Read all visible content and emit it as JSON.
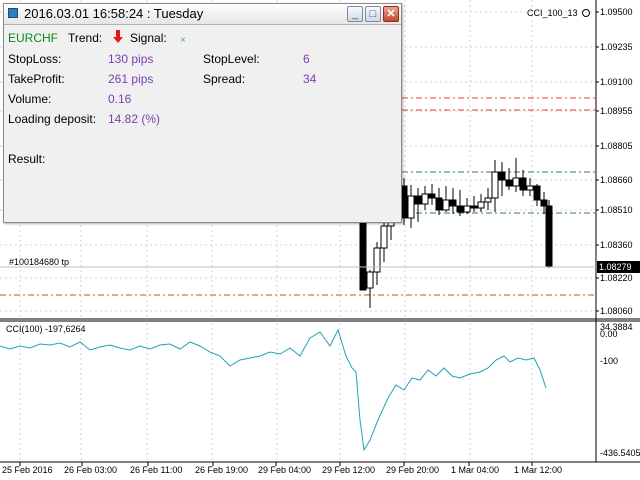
{
  "chart": {
    "indicator_name": "CCI_100_13",
    "price_tag": "1.08279",
    "order_label": "#100184680 tp",
    "price_ticks": [
      "1.09500",
      "1.09235",
      "1.09100",
      "1.08955",
      "1.08805",
      "1.08660",
      "1.08510",
      "1.08360",
      "1.08220",
      "1.08060"
    ],
    "cci_label": "CCI(100) -197,6264",
    "cci_ticks": [
      "34.3884",
      "0.00",
      "-100",
      "-436.5405"
    ],
    "time_ticks": [
      "25 Feb 2016",
      "26 Feb 03:00",
      "26 Feb 11:00",
      "26 Feb 19:00",
      "29 Feb 04:00",
      "29 Feb 12:00",
      "29 Feb 20:00",
      "1 Mar 04:00",
      "1 Mar 12:00"
    ],
    "colors": {
      "cci_line": "#22a3b4",
      "level_red": "#e0471c",
      "level_green": "#2f8a2f",
      "price_tag_bg": "#000000"
    }
  },
  "panel": {
    "title": "2016.03.01 16:58:24 : Tuesday",
    "symbol": "EURCHF",
    "trend_label": "Trend:",
    "trend_icon": "down-arrow-icon",
    "signal_label": "Signal:",
    "signal_icon": "small-x-icon",
    "rows": [
      {
        "label": "StopLoss:",
        "value": "130 pips"
      },
      {
        "label": "TakeProfit:",
        "value": "261 pips"
      },
      {
        "label": "Volume:",
        "value": "0.16"
      },
      {
        "label": "Loading deposit:",
        "value": "14.82 (%)"
      }
    ],
    "right_rows": [
      {
        "label": "StopLevel:",
        "value": "6"
      },
      {
        "label": "Spread:",
        "value": "34"
      }
    ],
    "result_label": "Result:"
  }
}
